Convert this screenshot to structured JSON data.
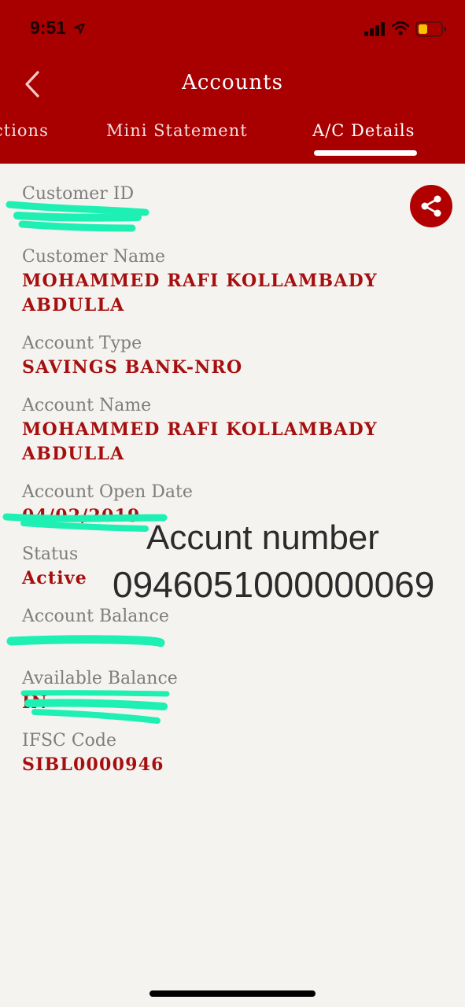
{
  "status_bar": {
    "time": "9:51",
    "battery_color": "#f5c400"
  },
  "header": {
    "title": "Accounts",
    "tabs": [
      {
        "label": "ctions"
      },
      {
        "label": "Mini Statement"
      },
      {
        "label": "A/C Details",
        "active": true
      }
    ]
  },
  "details": {
    "customer_id": {
      "label": "Customer ID",
      "value": ""
    },
    "customer_name": {
      "label": "Customer Name",
      "value_line1": "MOHAMMED RAFI KOLLAMBADY",
      "value_line2": "ABDULLA"
    },
    "account_type": {
      "label": "Account Type",
      "value": "SAVINGS BANK-NRO"
    },
    "account_name": {
      "label": "Account Name",
      "value_line1": "MOHAMMED RAFI KOLLAMBADY",
      "value_line2": "ABDULLA"
    },
    "account_open_date": {
      "label": "Account Open Date",
      "value": "04/02/2019"
    },
    "status": {
      "label": "Status",
      "value": "Active"
    },
    "account_balance": {
      "label": "Account Balance",
      "value": ""
    },
    "available_balance": {
      "label": "Available Balance",
      "value": "IN"
    },
    "ifsc_code": {
      "label": "IFSC Code",
      "value": "SIBL0000946"
    }
  },
  "annotation": {
    "title": "Accunt number",
    "number": "0946051000000069"
  },
  "colors": {
    "header_bg": "#a80000",
    "value_text": "#a60f0f",
    "label_text": "#7d7d7d",
    "redaction": "#1ef0b4"
  },
  "icons": {
    "back": "chevron-left-icon",
    "share": "share-icon"
  }
}
